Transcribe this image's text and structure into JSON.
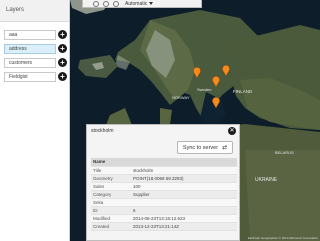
{
  "toolbar": {
    "mode_label": "Automatic"
  },
  "layers": {
    "title": "Layers",
    "items": [
      {
        "label": "aaa",
        "active": false
      },
      {
        "label": "address",
        "active": true
      },
      {
        "label": "customers",
        "active": false
      },
      {
        "label": "Fieldgist",
        "active": false
      }
    ]
  },
  "map_labels": {
    "finland": "FINLAND",
    "norway": "NORWAY",
    "sweden": "Sweden",
    "belarus": "BELARUS",
    "ukraine": "UKRAINE"
  },
  "popup": {
    "title": "stockholm",
    "sync_label": "Sync to server",
    "attributes": [
      {
        "key": "Name",
        "value": ""
      },
      {
        "key": "Title",
        "value": "stockholm"
      },
      {
        "key": "Geometry",
        "value": "POINT(18.0068 59.3293)"
      },
      {
        "key": "Sales",
        "value": "100"
      },
      {
        "key": "Category",
        "value": "Supplier"
      },
      {
        "key": "Seka",
        "value": ""
      },
      {
        "key": "ID",
        "value": "6"
      },
      {
        "key": "Modified",
        "value": "2014-06-23T13:15:12.523"
      },
      {
        "key": "Created",
        "value": "2013-12-23T13:21:14Z"
      }
    ]
  },
  "attribution": "Earthstar Geographics © 2014 Microsoft Corporation"
}
